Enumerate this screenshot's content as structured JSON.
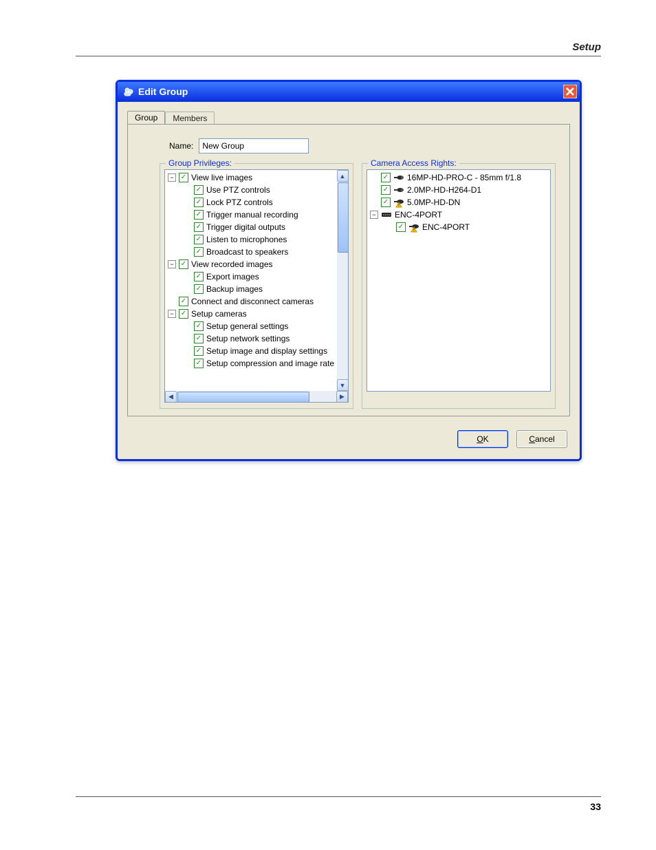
{
  "page": {
    "header": "Setup",
    "number": "33"
  },
  "dialog": {
    "title": "Edit Group",
    "tabs": [
      "Group",
      "Members"
    ],
    "active_tab": 0,
    "name_label": "Name:",
    "name_value": "New Group",
    "ok": "OK",
    "ok_accel_index": 0,
    "cancel": "Cancel",
    "cancel_accel_index": 0,
    "group_privileges": {
      "title": "Group Privileges:",
      "nodes": [
        {
          "depth": 0,
          "expand": "-",
          "checked": true,
          "label": "View live images"
        },
        {
          "depth": 1,
          "checked": true,
          "label": "Use PTZ controls"
        },
        {
          "depth": 1,
          "checked": true,
          "label": "Lock PTZ controls"
        },
        {
          "depth": 1,
          "checked": true,
          "label": "Trigger manual recording"
        },
        {
          "depth": 1,
          "checked": true,
          "label": "Trigger digital outputs"
        },
        {
          "depth": 1,
          "checked": true,
          "label": "Listen to microphones"
        },
        {
          "depth": 1,
          "checked": true,
          "label": "Broadcast to speakers"
        },
        {
          "depth": 0,
          "expand": "-",
          "checked": true,
          "label": "View recorded images"
        },
        {
          "depth": 1,
          "checked": true,
          "label": "Export images"
        },
        {
          "depth": 1,
          "checked": true,
          "label": "Backup images"
        },
        {
          "depth": 0,
          "checked": true,
          "label": "Connect and disconnect cameras"
        },
        {
          "depth": 0,
          "expand": "-",
          "checked": true,
          "label": "Setup cameras"
        },
        {
          "depth": 1,
          "checked": true,
          "label": "Setup general settings"
        },
        {
          "depth": 1,
          "checked": true,
          "label": "Setup network settings"
        },
        {
          "depth": 1,
          "checked": true,
          "label": "Setup image and display settings"
        },
        {
          "depth": 1,
          "checked": true,
          "label": "Setup compression and image rate"
        }
      ]
    },
    "camera_access": {
      "title": "Camera Access Rights:",
      "nodes": [
        {
          "depth": 0,
          "checked": true,
          "icon": "camera",
          "label": "16MP-HD-PRO-C - 85mm f/1.8"
        },
        {
          "depth": 0,
          "checked": true,
          "icon": "camera",
          "label": "2.0MP-HD-H264-D1"
        },
        {
          "depth": 0,
          "checked": true,
          "icon": "camera-warn",
          "label": "5.0MP-HD-DN"
        },
        {
          "depth": 0,
          "expand": "-",
          "icon": "encoder",
          "label": "ENC-4PORT"
        },
        {
          "depth": 1,
          "checked": true,
          "icon": "camera-warn",
          "label": "ENC-4PORT"
        }
      ]
    }
  }
}
